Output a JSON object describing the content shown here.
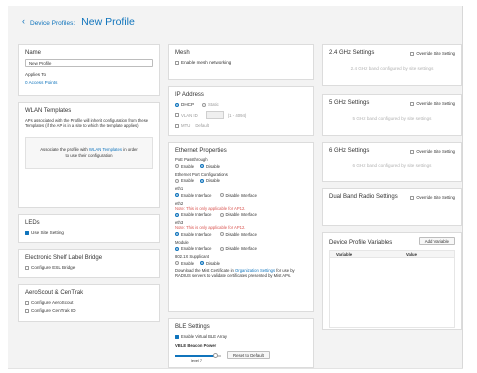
{
  "header": {
    "back_icon": "‹",
    "breadcrumb": "Device Profiles:",
    "title": "New Profile"
  },
  "name_card": {
    "name_label": "Name",
    "name_value": "New Profile",
    "applies_label": "Applies To",
    "applies_value": "0 Access Points"
  },
  "wlan": {
    "title": "WLAN Templates",
    "description": "APs associated with the Profile will inherit configuration from these Templates (if the AP is in a site to which the template applies)",
    "inset_prefix": "Associate the profile with ",
    "inset_link": "WLAN Templates",
    "inset_suffix": " in order to use their configuration"
  },
  "leds": {
    "title": "LEDs",
    "option": "Use Site Setting"
  },
  "esl": {
    "title": "Electronic Shelf Label Bridge",
    "option": "Configure ESL Bridge"
  },
  "aeroscout": {
    "title": "AeroScout & CenTrak",
    "option1": "Configure AeroScout",
    "option2": "Configure CenTrak ID"
  },
  "mesh": {
    "title": "Mesh",
    "option": "Enable mesh networking"
  },
  "ip": {
    "title": "IP Address",
    "dhcp": "DHCP",
    "static": "Static",
    "vlan": "VLAN ID",
    "vlan_range": "(1 - 4094)",
    "mtu": "MTU",
    "mtu_value": "Default"
  },
  "ethernet": {
    "title": "Ethernet Properties",
    "poe_label": "PoE Passthrough",
    "poe_enable": "Enable",
    "poe_disable": "Disable",
    "port_label": "Ethernet Port Configurations",
    "port_enable": "Enable",
    "port_disable": "Disable",
    "eth1_label": "eth1",
    "eth1_enable": "Enable Interface",
    "eth1_disable": "Disable Interface",
    "eth2_label": "eth2",
    "eth2_note": "Note: This is only applicable for AP12.",
    "eth2_enable": "Enable Interface",
    "eth2_disable": "Disable Interface",
    "eth3_label": "eth3",
    "eth3_note": "Note: This is only applicable for AP12.",
    "eth3_enable": "Enable Interface",
    "eth3_disable": "Disable Interface",
    "module_label": "Module",
    "module_enable": "Enable Interface",
    "module_disable": "Disable Interface",
    "supplicant_label": "802.1X Supplicant",
    "supplicant_enable": "Enable",
    "supplicant_disable": "Disable",
    "cert_prefix": "Download the Mist Certificate in ",
    "cert_link": "Organization Settings",
    "cert_suffix": " for use by RADIUS servers to validate certificates presented by Mist APs."
  },
  "ble": {
    "title": "BLE Settings",
    "option": "Enable Virtual BLE Array",
    "power_label": "VBLE Beacon Power",
    "power_value": "level 7",
    "power_level": 0.87,
    "reset_button": "Reset to Default"
  },
  "radio24": {
    "title": "2.4 GHz Settings",
    "override": "Override Site Setting",
    "placeholder": "2.4 GHz band configured by site settings"
  },
  "radio5": {
    "title": "5 GHz Settings",
    "override": "Override Site Setting",
    "placeholder": "5 GHz band configured by site settings"
  },
  "radio6": {
    "title": "6 GHz Settings",
    "override": "Override Site Setting",
    "placeholder": "6 GHz band configured by site settings"
  },
  "dualband": {
    "title": "Dual Band Radio Settings",
    "override": "Override Site Setting"
  },
  "variables": {
    "title": "Device Profile Variables",
    "add_button": "Add Variable",
    "col_variable": "Variable",
    "col_value": "Value"
  },
  "colors": {
    "accent": "#1074bc",
    "note": "#d9534f",
    "background": "#f3f3f3"
  }
}
